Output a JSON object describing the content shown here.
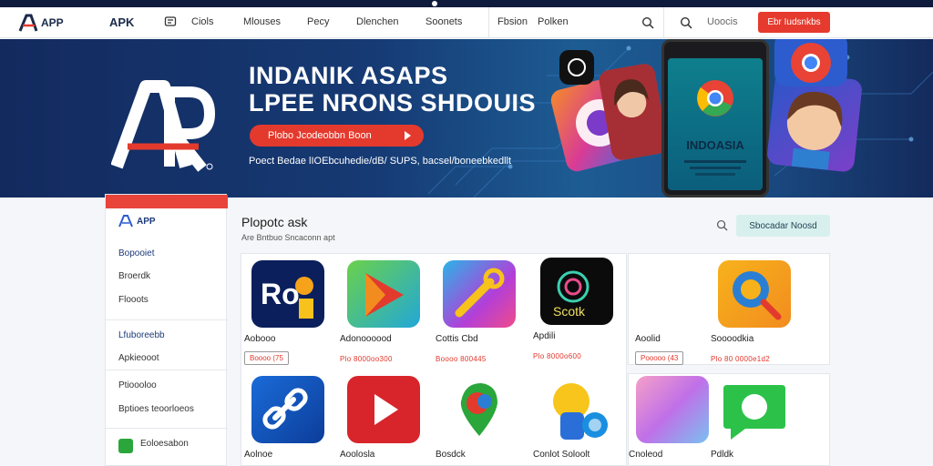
{
  "nav": {
    "logo_text": "APP",
    "brand": "APK",
    "items": [
      "Ciols",
      "Mlouses",
      "Pecy",
      "Dlenchen",
      "Soonets"
    ],
    "items2": [
      "Fbsion",
      "Polken"
    ],
    "search_label": "Uoocis",
    "cta": "Ebr Iudsnkbs"
  },
  "hero": {
    "title_line1": "INDANIK ASAPS",
    "title_line2": "LPEE NRONS SHDOUIS",
    "button": "Plobo Jcodeobbn Boon",
    "subtitle": "Poect Bedae lIOEbcuhedie/dB/ SUPS, bacsel/boneebkedllt",
    "phone_text": "INDOASIA"
  },
  "sidebar": {
    "brand": "APP",
    "items": [
      "Bopooiet",
      "Broerdk",
      "Flooots",
      "Lfuboreebb",
      "Apkieooot",
      "Ptioooloo",
      "Bptioes teoorloeos",
      "Eoloesabon"
    ]
  },
  "main": {
    "title": "Plopotc ask",
    "subtitle": "Are Bntbuo Sncaconn apt",
    "filter": "Sbocadar Noosd",
    "apps_row1": [
      {
        "name": "Aobooo",
        "meta": "Boooo (75",
        "tag": true
      },
      {
        "name": "Adonoooood",
        "meta": "Plo 8000oo300"
      },
      {
        "name": "Cottis Cbd",
        "meta": "Boooo 800445"
      },
      {
        "name": "Apdili",
        "meta": "Plo 8000o600"
      },
      {
        "name": "Aoolid",
        "meta": "Pooooo (43",
        "tag": true
      },
      {
        "name": "Soooodkia",
        "meta": "Plo 80 0000e1d2"
      }
    ],
    "apps_row2": [
      {
        "name": "Aolnoe"
      },
      {
        "name": "Aoolosla"
      },
      {
        "name": "Bosdck"
      },
      {
        "name": "Conlot Soloolt"
      },
      {
        "name": "Cnoleod"
      },
      {
        "name": "Pdldk"
      }
    ]
  },
  "colors": {
    "accent": "#e63a2e",
    "navy": "#132a5e",
    "teal": "#d7f0ee"
  }
}
